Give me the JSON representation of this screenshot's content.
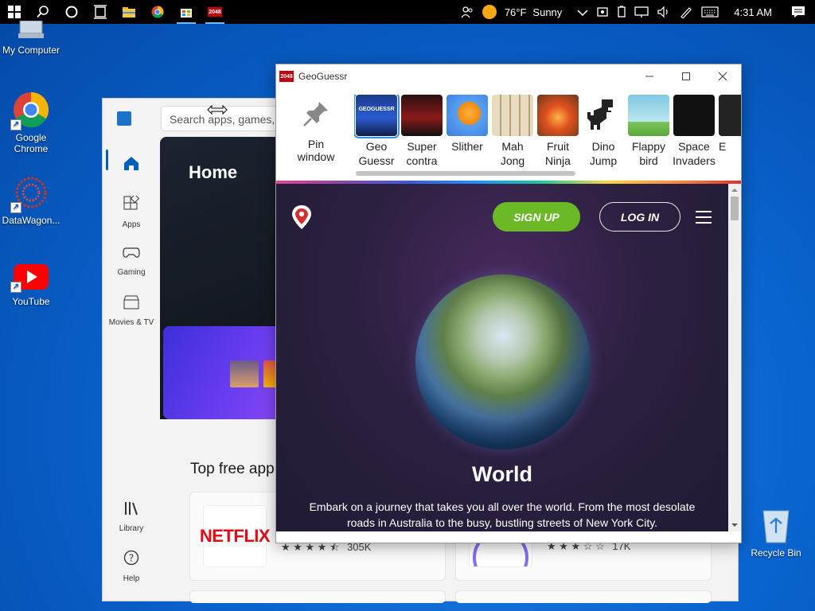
{
  "taskbar": {
    "weather_temp": "76°F",
    "weather_cond": "Sunny",
    "time": "4:31 AM"
  },
  "desktop": {
    "icons": [
      {
        "label": "My Computer"
      },
      {
        "label": "Google Chrome"
      },
      {
        "label": "DataWagon..."
      },
      {
        "label": "YouTube"
      },
      {
        "label": "Recycle Bin"
      }
    ]
  },
  "store": {
    "search_placeholder": "Search apps, games, m",
    "nav": [
      {
        "label": "Apps",
        "icon": "apps-icon"
      },
      {
        "label": "Gaming",
        "icon": "gamepad-icon"
      },
      {
        "label": "Movies & TV",
        "icon": "clapper-icon"
      }
    ],
    "bottom_nav": [
      {
        "label": "Library",
        "icon": "library-icon"
      },
      {
        "label": "Help",
        "icon": "help-icon"
      }
    ],
    "hero_title": "Home",
    "section_title": "Top free app",
    "apps": [
      {
        "logo": "NETFLIX",
        "stars": "★ ★ ★ ★ ⯪",
        "count": "305K"
      },
      {
        "stars": "★ ★ ★ ☆ ☆",
        "count": "17K"
      }
    ]
  },
  "geo": {
    "window_title": "GeoGuessr",
    "app_icon_text": "2048",
    "pin_label_1": "Pin",
    "pin_label_2": "window",
    "games": [
      {
        "l1": "Geo",
        "l2": "Guessr",
        "thumb_text": "GEOGUESSR"
      },
      {
        "l1": "Super",
        "l2": "contra"
      },
      {
        "l1": "Slither",
        "l2": ""
      },
      {
        "l1": "Mah",
        "l2": "Jong"
      },
      {
        "l1": "Fruit",
        "l2": "Ninja"
      },
      {
        "l1": "Dino",
        "l2": "Jump"
      },
      {
        "l1": "Flappy",
        "l2": "bird"
      },
      {
        "l1": "Space",
        "l2": "Invaders"
      },
      {
        "l1": "E",
        "l2": ""
      }
    ],
    "signup": "SIGN UP",
    "login": "LOG IN",
    "world_title": "World",
    "world_desc": "Embark on a journey that takes you all over the world. From the most desolate roads in Australia to the busy, bustling streets of New York City."
  }
}
